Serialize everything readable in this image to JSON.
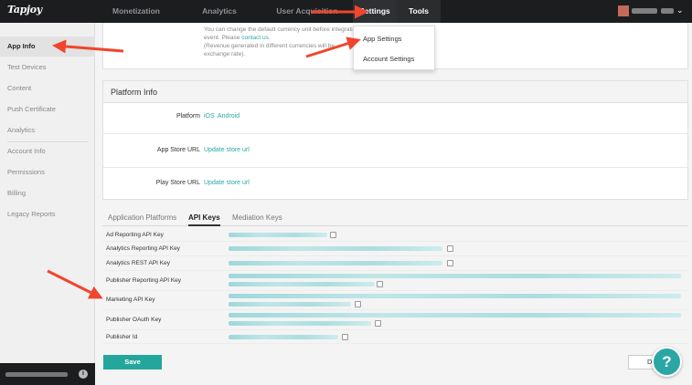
{
  "topbar": {
    "logo": "Tapjoy",
    "nav": [
      {
        "label": "Monetization"
      },
      {
        "label": "Analytics"
      },
      {
        "label": "User Acquisition"
      },
      {
        "label": "Settings"
      },
      {
        "label": "Tools"
      }
    ]
  },
  "dropdown": {
    "items": [
      "App Settings",
      "Account Settings"
    ]
  },
  "sidebar": {
    "items": [
      {
        "label": "App Info"
      },
      {
        "label": "Test Devices"
      },
      {
        "label": "Content"
      },
      {
        "label": "Push Certificate"
      },
      {
        "label": "Analytics"
      },
      {
        "label": "Account Info"
      },
      {
        "label": "Permissions"
      },
      {
        "label": "Billing"
      },
      {
        "label": "Legacy Reports"
      }
    ],
    "info_icon": "i"
  },
  "currency_note": {
    "line1": "You can change the default currency unit before integrati",
    "line2_prefix": "event. Please ",
    "line2_link": "contact us",
    "line2_suffix": ".",
    "line3": "(Revenue generated in different currencies will be",
    "line4": "exchange rate)."
  },
  "platform_info": {
    "title": "Platform Info",
    "platform_label": "Platform",
    "platform_options": [
      "iOS",
      "Android"
    ],
    "app_store_label": "App Store URL",
    "app_store_link": "Update store url",
    "play_store_label": "Play Store URL",
    "play_store_link": "Update store url"
  },
  "tabs": [
    {
      "label": "Application Platforms"
    },
    {
      "label": "API Keys"
    },
    {
      "label": "Mediation Keys"
    }
  ],
  "api_keys": [
    {
      "label": "Ad Reporting API Key"
    },
    {
      "label": "Analytics Reporting API Key"
    },
    {
      "label": "Analytics REST API Key"
    },
    {
      "label": "Publisher Reporting API Key"
    },
    {
      "label": "Marketing API Key"
    },
    {
      "label": "Publisher OAuth Key"
    },
    {
      "label": "Publisher Id"
    }
  ],
  "footer": {
    "save_label": "Save",
    "d_label": "D",
    "help_label": "?"
  },
  "colors": {
    "accent": "#2aa7a5",
    "annotation_arrow": "#f0452e",
    "topbar": "#1c1d1f"
  }
}
